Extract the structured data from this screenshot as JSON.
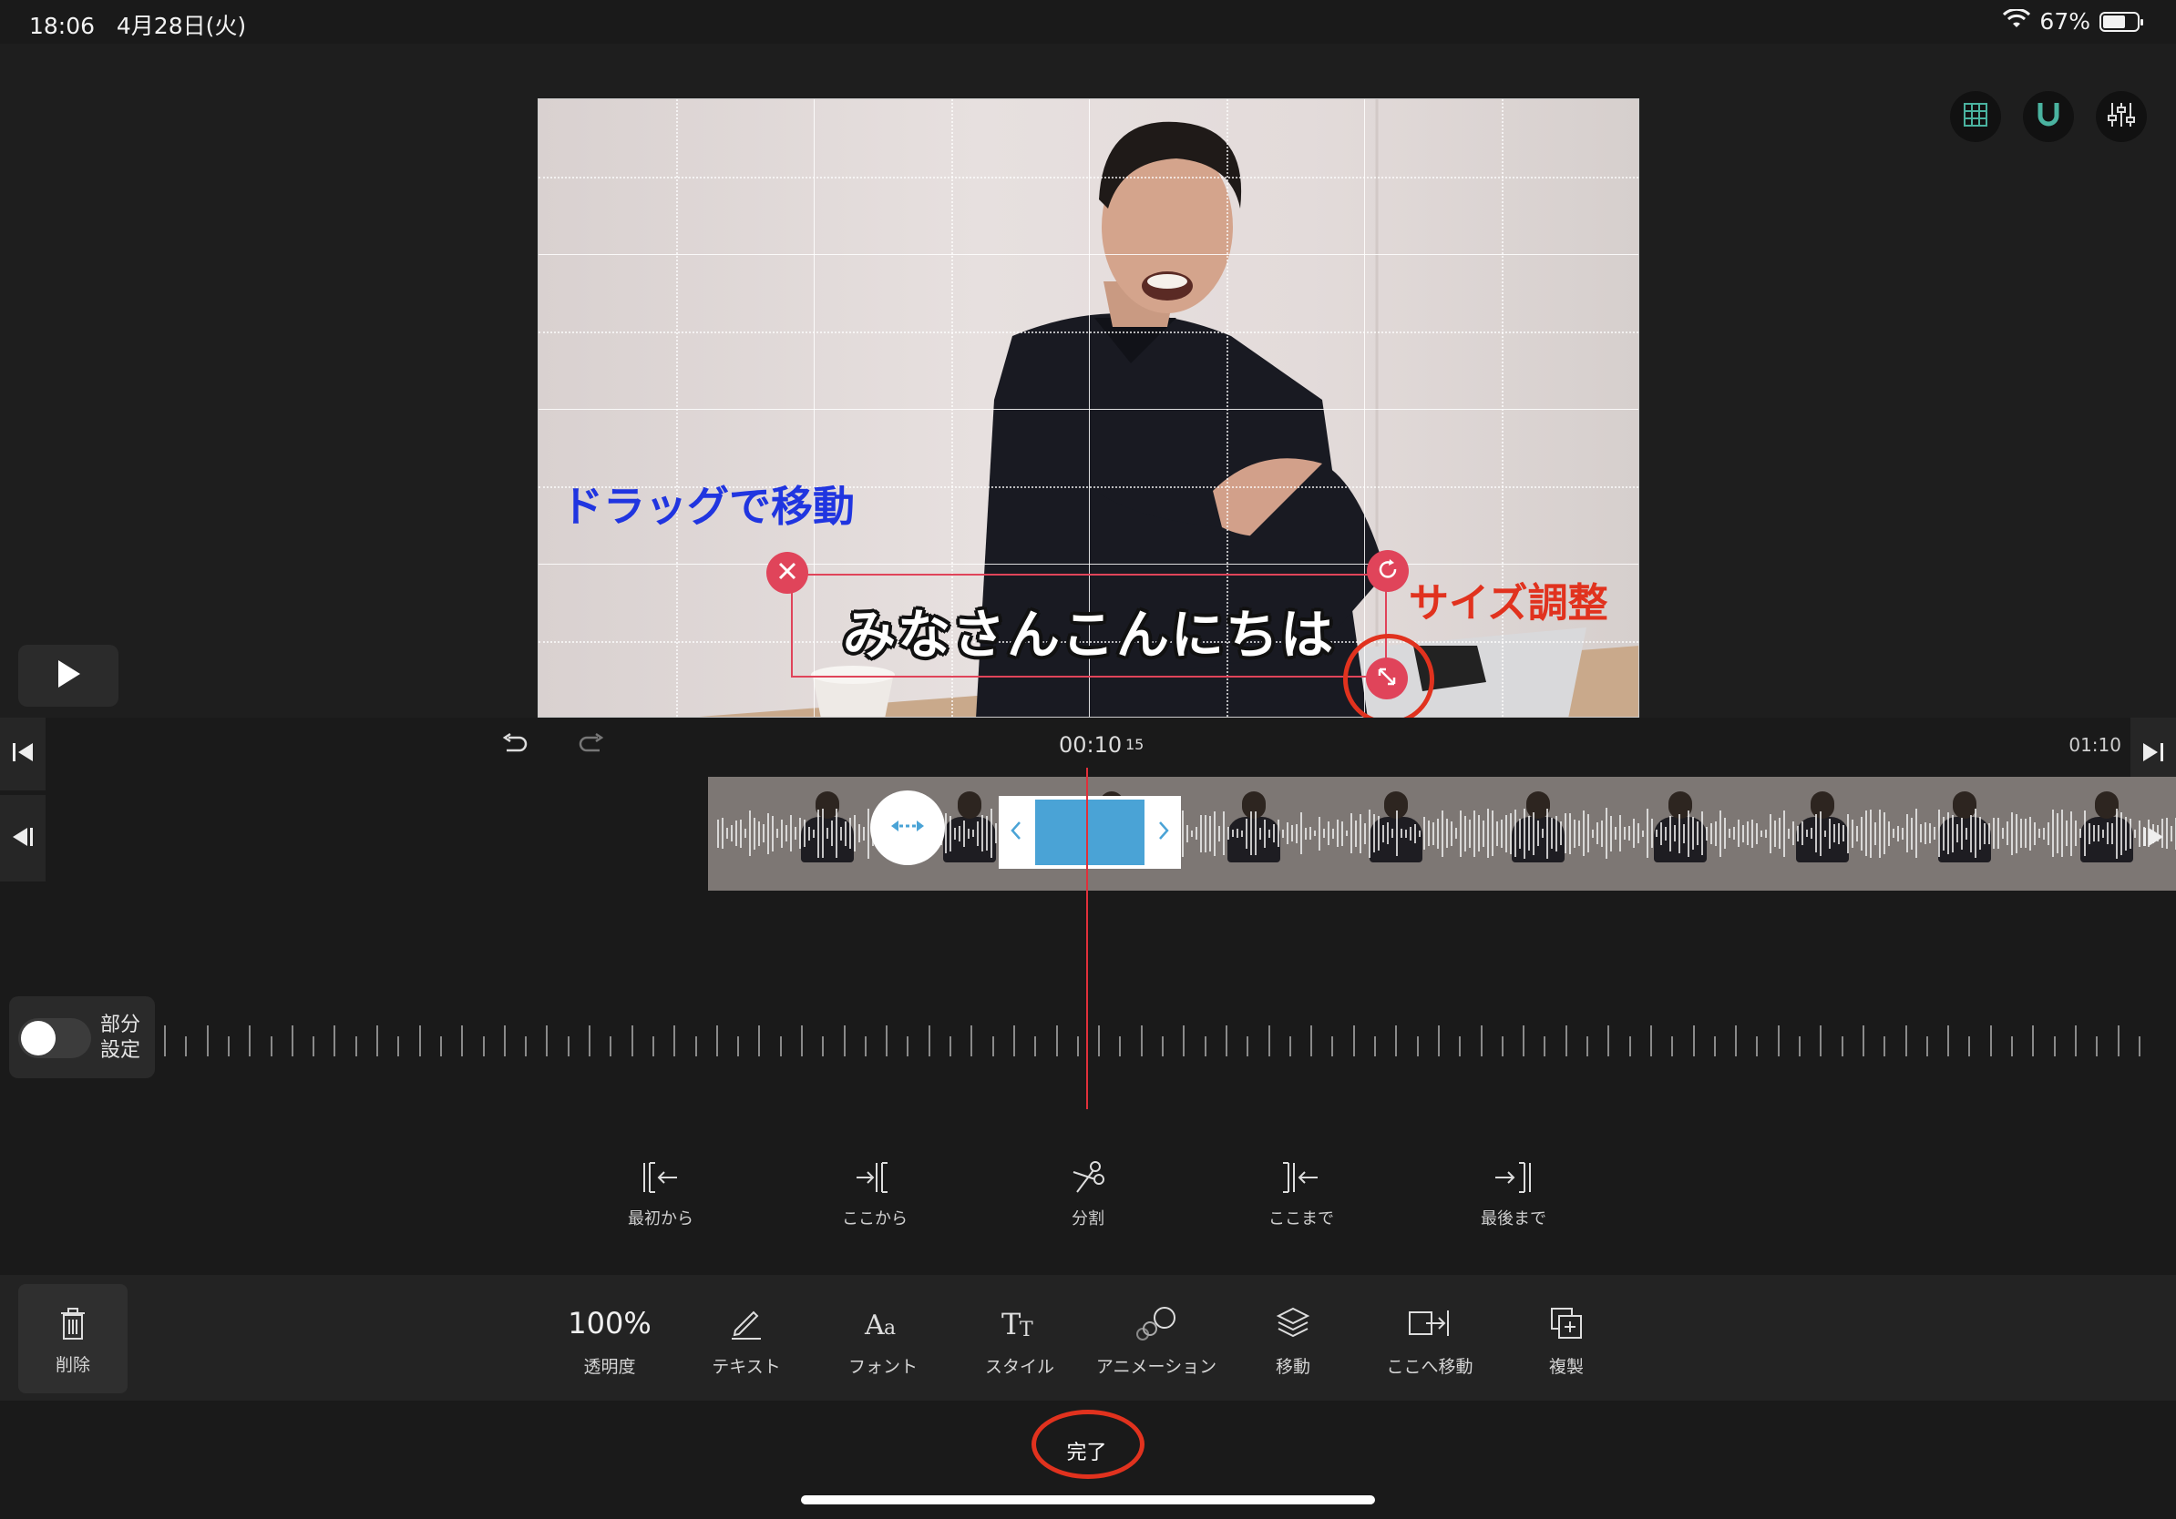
{
  "status": {
    "time": "18:06",
    "date": "4月28日(火)",
    "battery_percent": "67%",
    "battery_level": 0.67
  },
  "preview": {
    "caption_text": "みなさんこんにちは",
    "annotation_drag": "ドラッグで移動",
    "annotation_resize": "サイズ調整",
    "annotation_color": "#e1321e",
    "drag_color": "#2035e0"
  },
  "top_icons": [
    "grid-icon",
    "magnet-icon",
    "sliders-icon"
  ],
  "timeline": {
    "current_time": "00:10",
    "current_frame": "15",
    "total_time": "01:10"
  },
  "partial_setting": {
    "label": "部分\n設定",
    "enabled": false
  },
  "edit_actions": [
    {
      "label": "最初から",
      "icon": "trim-from-start-icon"
    },
    {
      "label": "ここから",
      "icon": "trim-from-here-icon"
    },
    {
      "label": "分割",
      "icon": "split-icon"
    },
    {
      "label": "ここまで",
      "icon": "trim-to-here-icon"
    },
    {
      "label": "最後まで",
      "icon": "trim-to-end-icon"
    }
  ],
  "toolbar": {
    "delete_label": "削除",
    "opacity_value": "100%",
    "opacity_label": "透明度",
    "text_label": "テキスト",
    "font_label": "フォント",
    "style_label": "スタイル",
    "animation_label": "アニメーション",
    "move_label": "移動",
    "move_here_label": "ここへ移動",
    "duplicate_label": "複製"
  },
  "done_label": "完了"
}
